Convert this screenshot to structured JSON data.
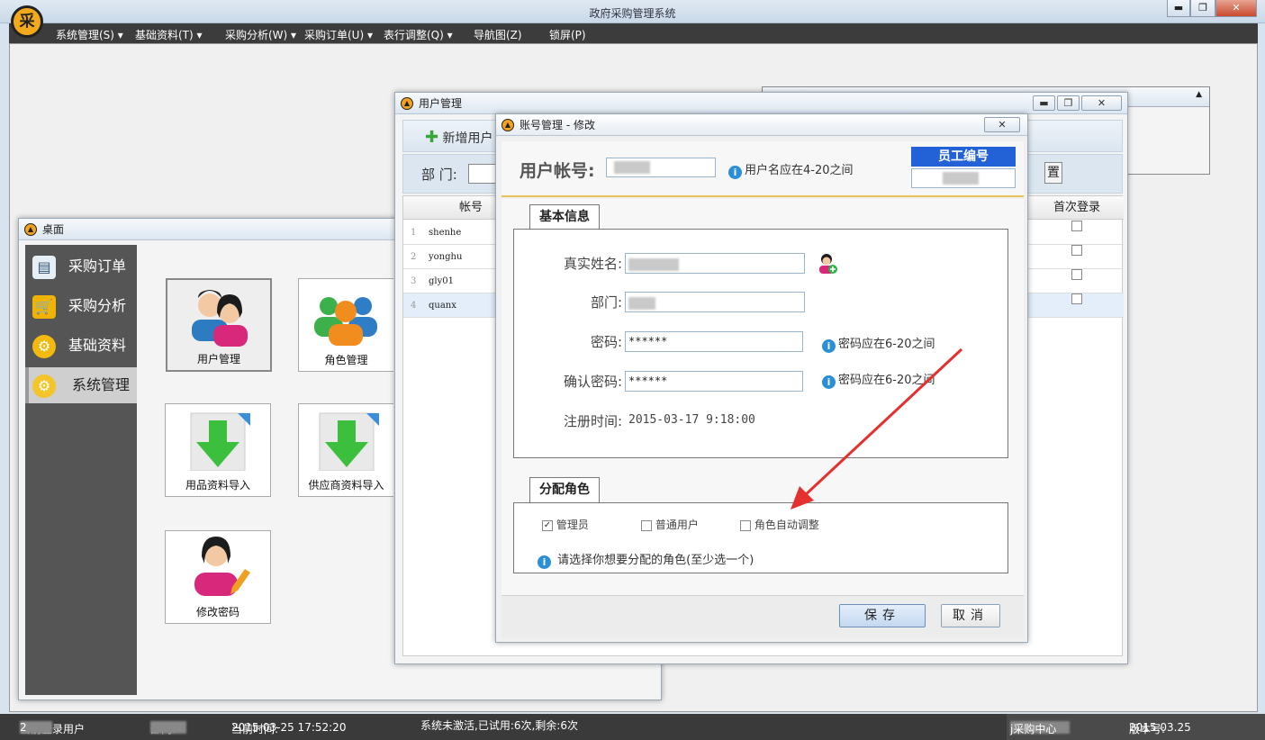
{
  "app": {
    "title": "政府采购管理系统",
    "logo_text": "采",
    "controls": [
      "▬",
      "❐",
      "✕"
    ]
  },
  "menu": [
    "系统管理(S)",
    "基础资料(T)",
    "采购分析(W)",
    "采购订单(U)",
    "表行调整(Q)",
    "导航图(Z)",
    "锁屏(P)"
  ],
  "bg_panel": {
    "controls": [
      "▲"
    ]
  },
  "desktop": {
    "title": "桌面",
    "sidebar": [
      "采购订单",
      "采购分析",
      "基础资料",
      "系统管理"
    ],
    "tiles": [
      "用户管理",
      "角色管理",
      "用品资料导入",
      "供应商资料导入",
      "修改密码"
    ]
  },
  "user_mgmt": {
    "title": "用户管理",
    "controls": [
      "▬",
      "❐",
      "✕"
    ],
    "add_label": "新增用户",
    "dept_label": "部  门:",
    "btn_right_fragment": "置",
    "columns": [
      "帐号",
      "首次登录"
    ],
    "rows": [
      {
        "n": "1",
        "acct": "shenhe"
      },
      {
        "n": "2",
        "acct": "yonghu"
      },
      {
        "n": "3",
        "acct": "gly01"
      },
      {
        "n": "4",
        "acct": "quanx"
      }
    ]
  },
  "edit": {
    "title": "账号管理 - 修改",
    "close": "✕",
    "account_label": "用户帐号:",
    "account_hint": "用户名应在4-20之间",
    "emp_no_label": "员工编号",
    "tab_basic": "基本信息",
    "realname_label": "真实姓名:",
    "dept_label": "部门:",
    "pwd_label": "密码:",
    "pwd_value": "******",
    "pwd_hint": "密码应在6-20之间",
    "confirm_label": "确认密码:",
    "confirm_value": "******",
    "confirm_hint": "密码应在6-20之间",
    "reg_label": "注册时间:",
    "reg_value": "2015-03-17 9:18:00",
    "tab_roles": "分配角色",
    "roles": [
      {
        "label": "管理员",
        "checked": true
      },
      {
        "label": "普通用户",
        "checked": false
      },
      {
        "label": "角色自动调整",
        "checked": false
      }
    ],
    "role_hint": "请选择你想要分配的角色(至少选一个)",
    "save": "保存",
    "cancel": "取消"
  },
  "status": {
    "user_label": "当前登录用户",
    "user_suffix": "2",
    "dept_label": "部门:",
    "time_label": "当前时间:",
    "time_value": "2015-03-25 17:52:20",
    "activation": "系统未激活,已试用:6次,剩余:6次",
    "center_fragment": "j采购中心",
    "version_label": "版本号:",
    "version_value": "2015.03.25"
  }
}
